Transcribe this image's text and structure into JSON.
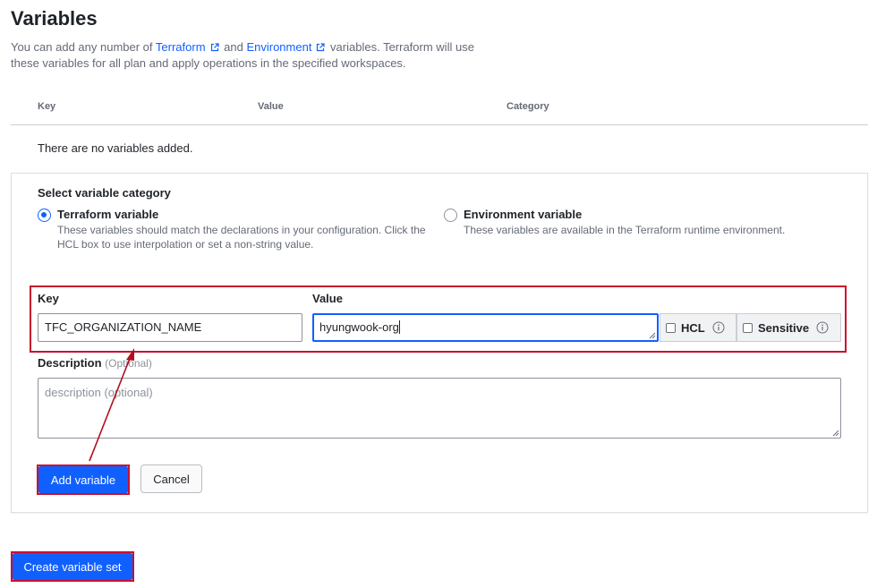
{
  "page": {
    "title": "Variables",
    "intro": {
      "prefix": "You can add any number of ",
      "link_terraform": "Terraform",
      "middle": " and ",
      "link_environment": "Environment",
      "suffix": " variables. Terraform will use these variables for all plan and apply operations in the specified workspaces."
    }
  },
  "table": {
    "columns": [
      "Key",
      "Value",
      "Category"
    ],
    "empty_message": "There are no variables added."
  },
  "form": {
    "category_label": "Select variable category",
    "options": [
      {
        "title": "Terraform variable",
        "description": "These variables should match the declarations in your configuration. Click the HCL box to use interpolation or set a non-string value.",
        "selected": true
      },
      {
        "title": "Environment variable",
        "description": "These variables are available in the Terraform runtime environment.",
        "selected": false
      }
    ],
    "key_label": "Key",
    "key_value": "TFC_ORGANIZATION_NAME",
    "value_label": "Value",
    "value_value": "hyungwook-org",
    "hcl_label": "HCL",
    "sensitive_label": "Sensitive",
    "description_label": "Description",
    "description_optional": "(Optional)",
    "description_placeholder": "description (optional)",
    "add_button": "Add variable",
    "cancel_button": "Cancel"
  },
  "footer": {
    "create_button": "Create variable set"
  },
  "colors": {
    "accent": "#1060ff",
    "highlight": "#c8102e"
  },
  "icons": [
    "external-link-icon",
    "info-icon",
    "resize-handle-icon"
  ]
}
